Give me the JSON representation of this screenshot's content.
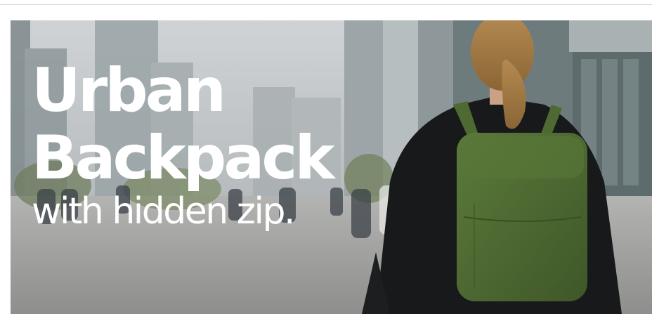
{
  "hero": {
    "title_line1": "Urban",
    "title_line2": "Backpack",
    "subtitle": "with hidden zip.",
    "text_color": "#ffffff",
    "backpack_color": "#4e6a32",
    "image_subject": "woman-walking-with-backpack-city-street"
  }
}
